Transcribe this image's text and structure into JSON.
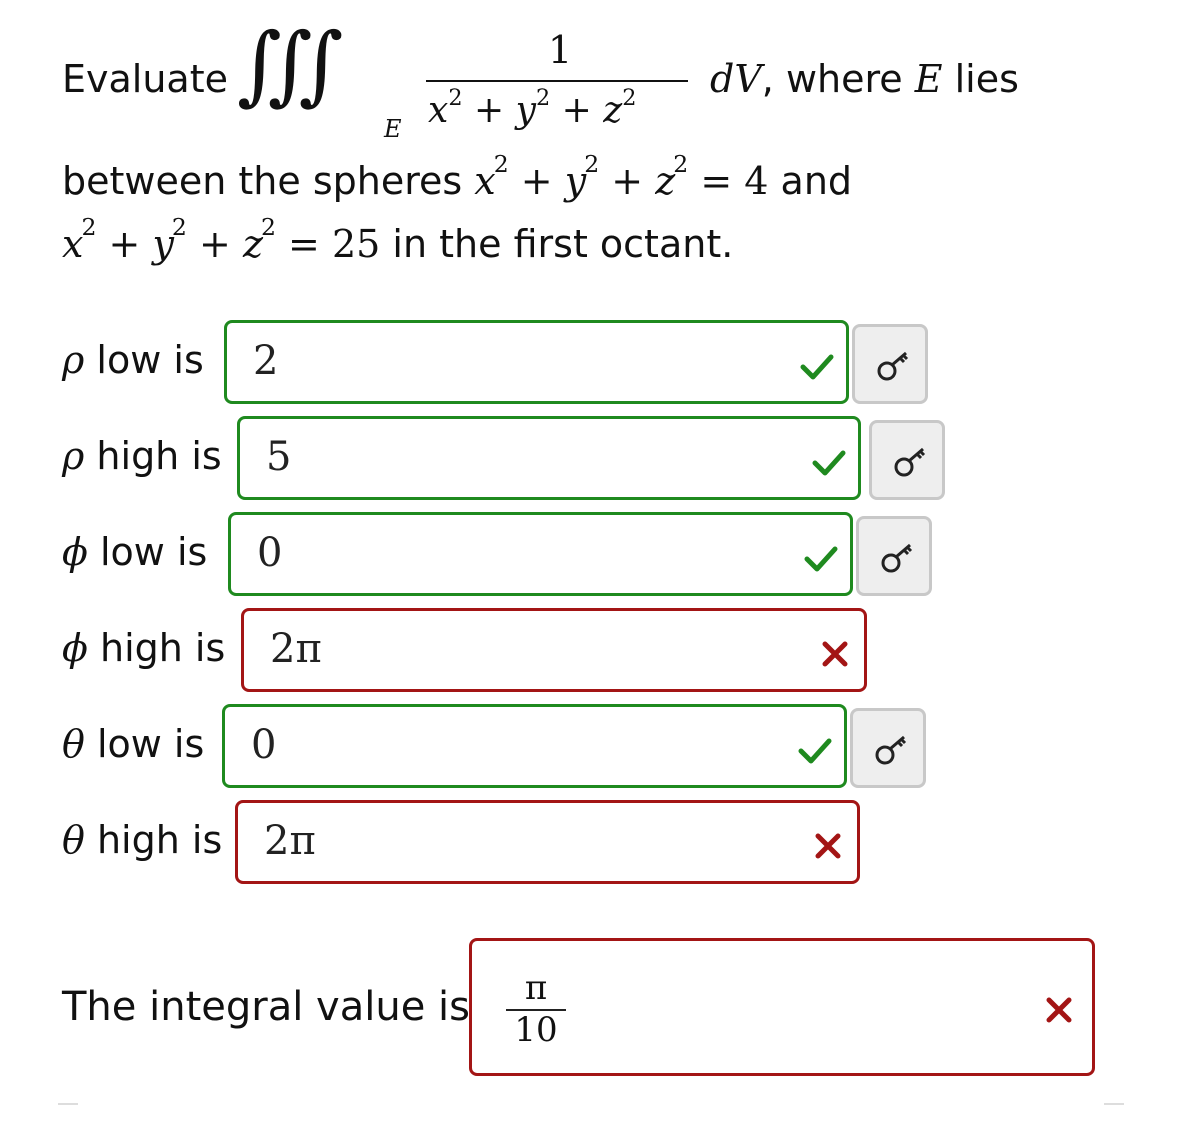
{
  "question": {
    "evaluate_word": "Evaluate",
    "integral_symbol": "∫∫∫",
    "region_sub": "E",
    "numerator": "1",
    "denominator_base_x": "x",
    "denominator_base_y": "y",
    "denominator_base_z": "z",
    "exponent": "2",
    "plus": "+",
    "differential": "dV",
    "after_integral": ", where",
    "region_var": "E",
    "lies_word": "lies",
    "line2_text_start": "between the spheres",
    "line2_rhs": "= 4",
    "line2_end": "and",
    "line3_rhs": "= 25",
    "line3_end": "in the first octant."
  },
  "rows": [
    {
      "symbol": "ρ",
      "label_text": " low is",
      "value": "2",
      "status": "correct",
      "has_key": true
    },
    {
      "symbol": "ρ",
      "label_text": " high is",
      "value": "5",
      "status": "correct",
      "has_key": true
    },
    {
      "symbol": "ϕ",
      "label_text": " low is",
      "value": "0",
      "status": "correct",
      "has_key": true
    },
    {
      "symbol": "ϕ",
      "label_text": " high is",
      "value": "2π",
      "status": "incorrect",
      "has_key": false
    },
    {
      "symbol": "θ",
      "label_text": " low is",
      "value": "0",
      "status": "correct",
      "has_key": true
    },
    {
      "symbol": "θ",
      "label_text": " high is",
      "value": "2π",
      "status": "incorrect",
      "has_key": false
    }
  ],
  "final": {
    "label": "The integral value is",
    "numerator": "π",
    "denominator": "10",
    "status": "incorrect"
  },
  "colors": {
    "correct": "#1f8a1f",
    "incorrect": "#a31515",
    "key_button_bg": "#eeeeee",
    "key_button_border": "#c8c8c8"
  },
  "icons": {
    "correct": "check-icon",
    "incorrect": "cross-icon",
    "key": "key-icon"
  }
}
